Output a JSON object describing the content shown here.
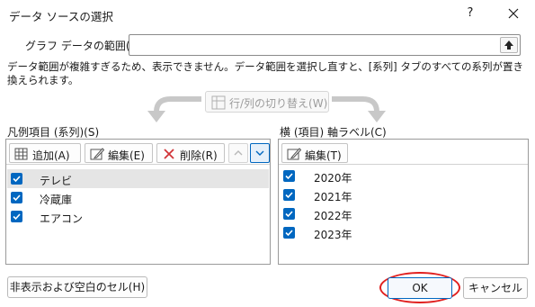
{
  "window": {
    "title": "データ ソースの選択",
    "help": "?"
  },
  "range": {
    "label": "グラフ データの範囲(D):",
    "value": ""
  },
  "notice": "データ範囲が複雑すぎるため、表示できません。データ範囲を選択し直すと、[系列] タブのすべての系列が置き換えられます。",
  "switch_button": "行/列の切り替え(W)",
  "legend": {
    "title": "凡例項目 (系列)(S)",
    "add": "追加(A)",
    "edit": "編集(E)",
    "delete": "削除(R)",
    "items": [
      {
        "label": "テレビ",
        "checked": true,
        "selected": true
      },
      {
        "label": "冷蔵庫",
        "checked": true,
        "selected": false
      },
      {
        "label": "エアコン",
        "checked": true,
        "selected": false
      }
    ]
  },
  "axis": {
    "title": "横 (項目) 軸ラベル(C)",
    "edit": "編集(T)",
    "items": [
      {
        "label": "2020年",
        "checked": true
      },
      {
        "label": "2021年",
        "checked": true
      },
      {
        "label": "2022年",
        "checked": true
      },
      {
        "label": "2023年",
        "checked": true
      }
    ]
  },
  "footer": {
    "hidden_cells": "非表示および空白のセル(H)",
    "ok": "OK",
    "cancel": "キャンセル"
  },
  "colors": {
    "accent": "#0067c0",
    "highlight_ring": "#e0201f"
  }
}
